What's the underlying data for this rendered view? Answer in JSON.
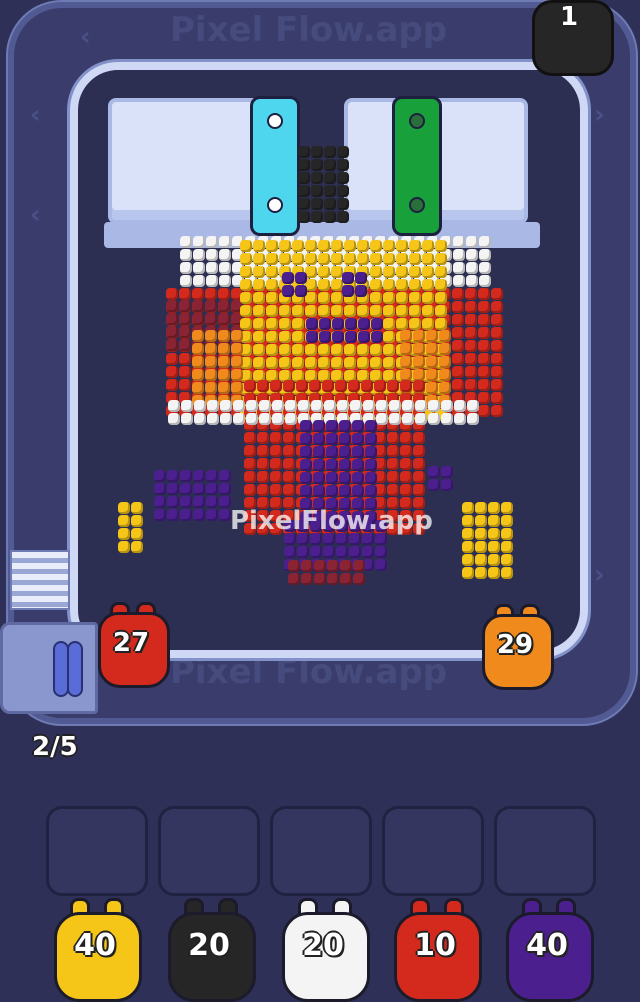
{
  "watermark": "Pixel Flow.app",
  "watermark_center": "PixelFlow.app",
  "lives_count": "1",
  "queue_progress": "2/5",
  "colors": {
    "yellow": "#f5c518",
    "orange": "#f08a1c",
    "red": "#d42a1e",
    "white": "#f4f4f4",
    "black": "#262626",
    "purple": "#4b1f8e",
    "maroon": "#8a2435",
    "pole_cyan": "#4fd6ef",
    "pole_green": "#18a13a"
  },
  "track_pigs": [
    {
      "label": "27",
      "color": "#d42a1e"
    },
    {
      "label": "29",
      "color": "#f08a1c"
    }
  ],
  "queue_pigs": [
    {
      "label": "40",
      "color": "#f5c518"
    },
    {
      "label": "20",
      "color": "#262626"
    },
    {
      "label": "20",
      "color": "#f4f4f4"
    },
    {
      "label": "10",
      "color": "#d42a1e"
    },
    {
      "label": "40",
      "color": "#4b1f8e"
    }
  ],
  "empty_slots": 5
}
